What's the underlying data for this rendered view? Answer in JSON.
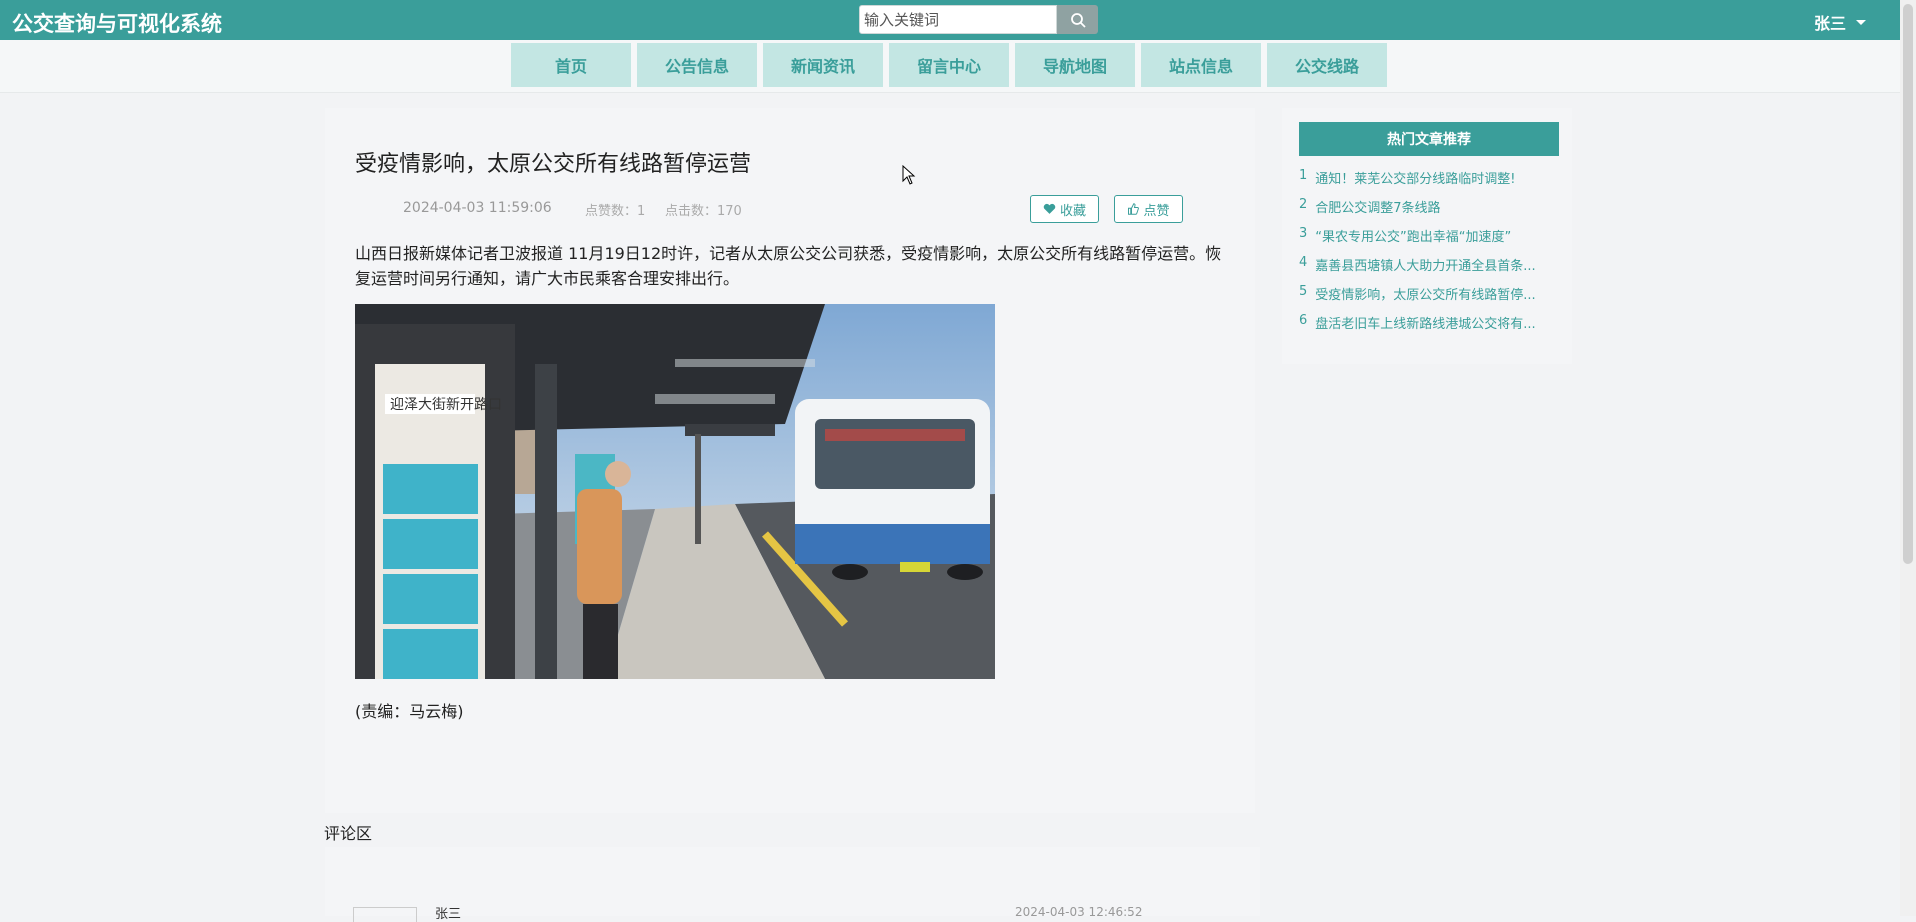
{
  "app": {
    "title": "公交查询与可视化系统",
    "user": "张三",
    "search_placeholder": "输入关键词"
  },
  "nav": {
    "items": [
      "首页",
      "公告信息",
      "新闻资讯",
      "留言中心",
      "导航地图",
      "站点信息",
      "公交线路"
    ]
  },
  "article": {
    "title": "受疫情影响，太原公交所有线路暂停运营",
    "date": "2024-04-03 11:59:06",
    "likes": "点赞数：1",
    "clicks": "点击数：170",
    "favorite_label": "收藏",
    "like_label": "点赞",
    "body": "山西日报新媒体记者卫波报道 11月19日12时许，记者从太原公交公司获悉，受疫情影响，太原公交所有线路暂停运营。恢复运营时间另行通知，请广大市民乘客合理安排出行。",
    "photo_sign": "迎泽大街新开路口",
    "editor": "(责编：马云梅)"
  },
  "comments": {
    "label": "评论区",
    "items": [
      {
        "user": "张三",
        "time": "2024-04-03 12:46:52"
      }
    ]
  },
  "sidebar": {
    "header": "热门文章推荐",
    "items": [
      {
        "num": "1",
        "text": "通知！莱芜公交部分线路临时调整!"
      },
      {
        "num": "2",
        "text": "合肥公交调整7条线路"
      },
      {
        "num": "3",
        "text": "“果农专用公交”跑出幸福“加速度”"
      },
      {
        "num": "4",
        "text": "嘉善县西塘镇人大助力开通全县首条..."
      },
      {
        "num": "5",
        "text": "受疫情影响，太原公交所有线路暂停..."
      },
      {
        "num": "6",
        "text": "盘活老旧车上线新路线港城公交将有..."
      }
    ]
  },
  "colors": {
    "primary": "#3a9e9a",
    "nav_bg": "#c3e6e3"
  },
  "icons": [
    "search-icon",
    "heart-icon",
    "thumbs-up-icon",
    "chevron-down-icon"
  ]
}
